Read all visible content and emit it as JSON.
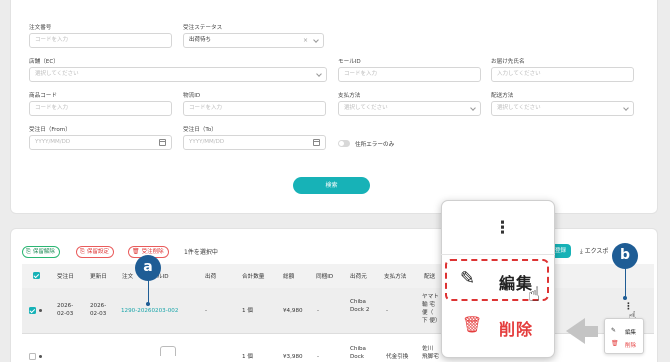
{
  "filters": {
    "order_no": {
      "label": "注文番号",
      "placeholder": "コードを入力"
    },
    "order_status": {
      "label": "受注ステータス",
      "value": "出荷待ち"
    },
    "store": {
      "label": "店舗（EC）",
      "placeholder": "選択してください"
    },
    "mall_id": {
      "label": "モールID",
      "placeholder": "コードを入力"
    },
    "recipient": {
      "label": "お届け先氏名",
      "placeholder": "入力してください"
    },
    "product_code": {
      "label": "商品コード",
      "placeholder": "コードを入力"
    },
    "logistics_id": {
      "label": "物流ID",
      "placeholder": "コードを入力"
    },
    "payment": {
      "label": "支払方法",
      "placeholder": "選択してください"
    },
    "delivery": {
      "label": "配送方法",
      "placeholder": "選択してください"
    },
    "date_from": {
      "label": "受注日（From）",
      "placeholder": "YYYY/MM/DD"
    },
    "date_to": {
      "label": "受注日（To）",
      "placeholder": "YYYY/MM/DD"
    },
    "error_only_label": "住所エラーのみ",
    "error_only_on": false,
    "search_label": "検索"
  },
  "toolbar": {
    "release_hold": "保留解除",
    "set_hold": "保留設定",
    "cancel_order": "受注削除",
    "selection_count": "1件を選択中",
    "register_partial": "登録",
    "export_label": "エクスポ"
  },
  "table": {
    "headers": [
      "受注日",
      "更新日",
      "注文",
      "ルID",
      "出荷",
      "合計数量",
      "総額",
      "同梱ID",
      "出荷元",
      "支払方法",
      "配送"
    ],
    "rows": [
      {
        "order_date": "2026-02-03",
        "updated": "2026-02-03",
        "mall_id": "1290-20260203-002",
        "ship": "-",
        "qty": "1 個",
        "total": "¥4,980",
        "bundle": "-",
        "origin": "Chiba Dock 2",
        "payment": "-",
        "delivery": "ヤマト 輸 宅 便（ 下 便）"
      },
      {
        "order_date": "",
        "updated": "",
        "mall_id": "",
        "ship": "",
        "qty": "1 個",
        "total": "¥3,980",
        "bundle": "-",
        "origin": "Chiba Dock",
        "payment": "代金引換",
        "delivery": "佐川 飛脚宅"
      }
    ]
  },
  "zoom_menu": {
    "edit_label": "編集",
    "delete_label": "削除"
  },
  "small_menu": {
    "edit_label": "編集",
    "delete_label": "削除"
  },
  "callouts": {
    "a": "a",
    "b": "b"
  },
  "colors": {
    "accent": "#17b2b7",
    "callout": "#1f5d95",
    "danger": "#e43c3c",
    "success": "#2bb673"
  }
}
